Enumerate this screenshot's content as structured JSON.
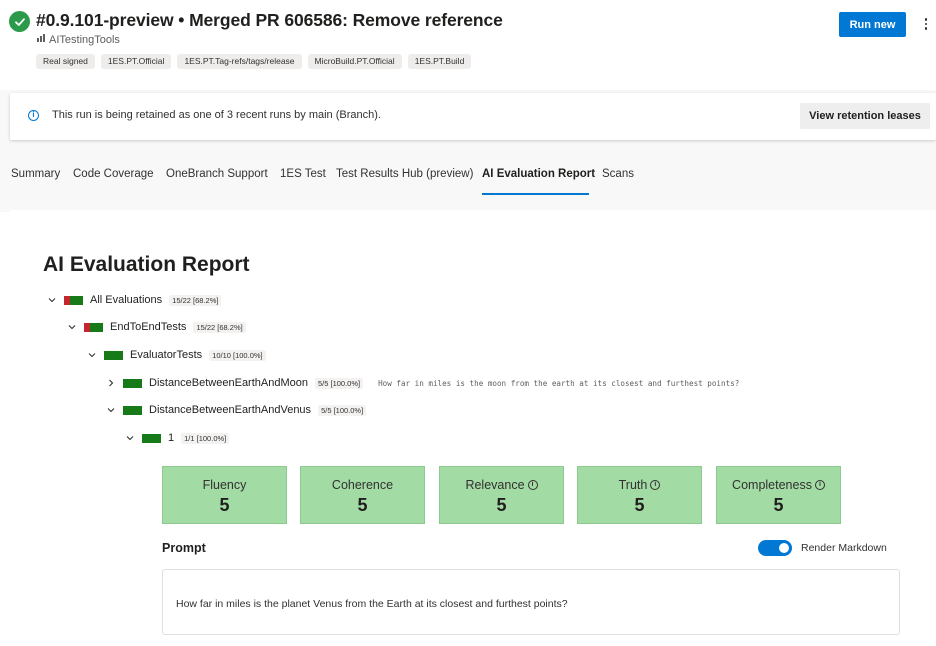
{
  "header": {
    "status_icon": "check-circle-icon",
    "status_color": "#2b9a4a",
    "title": "#0.9.101-preview • Merged PR 606586: Remove reference",
    "pipeline_icon": "pipeline-icon",
    "pipeline_name": "AITestingTools",
    "tags": [
      "Real signed",
      "1ES.PT.Official",
      "1ES.PT.Tag-refs/tags/release",
      "MicroBuild.PT.Official",
      "1ES.PT.Build"
    ],
    "run_new_label": "Run new",
    "more_icon": "more-vertical-icon"
  },
  "banner": {
    "icon": "info-icon",
    "text": "This run is being retained as one of 3 recent runs by main (Branch).",
    "button_label": "View retention leases"
  },
  "tabs": [
    {
      "label": "Summary",
      "active": false
    },
    {
      "label": "Code Coverage",
      "active": false
    },
    {
      "label": "OneBranch Support",
      "active": false
    },
    {
      "label": "1ES Test",
      "active": false
    },
    {
      "label": "Test Results Hub (preview)",
      "active": false
    },
    {
      "label": "AI Evaluation Report",
      "active": true
    },
    {
      "label": "Scans",
      "active": false
    }
  ],
  "report": {
    "title": "AI Evaluation Report",
    "tree": [
      {
        "label": "All Evaluations",
        "score": "15/22 [68.2%]",
        "pass_fraction": 0.682,
        "expanded": true,
        "desc": ""
      },
      {
        "label": "EndToEndTests",
        "score": "15/22 [68.2%]",
        "pass_fraction": 0.682,
        "expanded": true,
        "desc": ""
      },
      {
        "label": "EvaluatorTests",
        "score": "10/10 [100.0%]",
        "pass_fraction": 1.0,
        "expanded": true,
        "desc": ""
      },
      {
        "label": "DistanceBetweenEarthAndMoon",
        "score": "5/5 [100.0%]",
        "pass_fraction": 1.0,
        "expanded": false,
        "desc": "How far in miles is the moon from the earth at its closest and furthest points?"
      },
      {
        "label": "DistanceBetweenEarthAndVenus",
        "score": "5/5 [100.0%]",
        "pass_fraction": 1.0,
        "expanded": true,
        "desc": ""
      },
      {
        "label": "1",
        "score": "1/1 [100.0%]",
        "pass_fraction": 1.0,
        "expanded": true,
        "desc": ""
      }
    ],
    "metrics": [
      {
        "name": "Fluency",
        "value": "5",
        "info": false
      },
      {
        "name": "Coherence",
        "value": "5",
        "info": true
      },
      {
        "name": "Relevance",
        "value": "5",
        "info": true
      },
      {
        "name": "Truth",
        "value": "5",
        "info": true
      },
      {
        "name": "Completeness",
        "value": "5",
        "info": true
      }
    ],
    "prompt_heading": "Prompt",
    "render_markdown_label": "Render Markdown",
    "render_markdown_on": true,
    "prompt_text": "How far in miles is the planet Venus from the Earth at its closest and furthest points?"
  },
  "colors": {
    "accent": "#0078d4",
    "pass": "#157a17",
    "fail": "#c4262e",
    "metric_bg": "#a3dba5"
  }
}
